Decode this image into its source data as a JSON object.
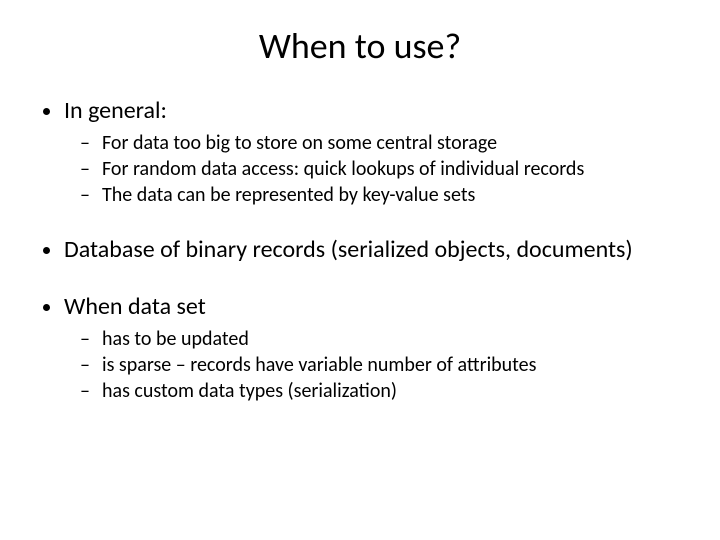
{
  "title": "When to use?",
  "bullets": {
    "b1": {
      "label": "In general:",
      "sub": [
        "For data too big to store on some central storage",
        "For random data access: quick lookups of individual records",
        "The data can be represented by key-value sets"
      ]
    },
    "b2": {
      "label": "Database of binary records (serialized objects, documents)"
    },
    "b3": {
      "label": "When data set",
      "sub": [
        "has to be updated",
        "is sparse – records have variable number of attributes",
        "has custom data types (serialization)"
      ]
    }
  }
}
